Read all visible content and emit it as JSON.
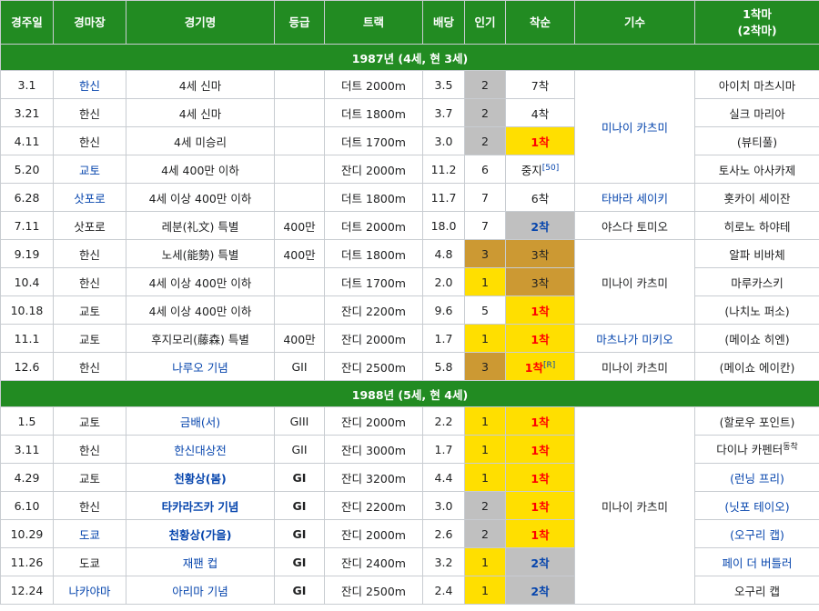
{
  "headers": [
    "경주일",
    "경마장",
    "경기명",
    "등급",
    "트랙",
    "배당",
    "인기",
    "착순",
    "기수",
    "1착마",
    "(2착마)"
  ],
  "sections": {
    "s1987": "1987년 (4세, 현 3세)",
    "s1988": "1988년 (5세, 현 4세)"
  },
  "rows": [
    {
      "date": "3.1",
      "venue": "한신",
      "race": "4세 신마",
      "grade": "",
      "track": "더트 2000m",
      "odds": "3.5",
      "pop": "2",
      "finish": "7착",
      "winner": "아이치 마츠시마"
    },
    {
      "date": "3.21",
      "venue": "한신",
      "race": "4세 신마",
      "grade": "",
      "track": "더트 1800m",
      "odds": "3.7",
      "pop": "2",
      "finish": "4착",
      "winner": "실크 마리아"
    },
    {
      "date": "4.11",
      "venue": "한신",
      "race": "4세 미승리",
      "grade": "",
      "track": "더트 1700m",
      "odds": "3.0",
      "pop": "2",
      "finish": "1착",
      "winner": "(뷰티풀)"
    },
    {
      "date": "5.20",
      "venue": "교토",
      "race": "4세 400만 이하",
      "grade": "",
      "track": "잔디 2000m",
      "odds": "11.2",
      "pop": "6",
      "finish": "중지",
      "finish_ref": "[50]",
      "winner": "토사노 아사카제"
    },
    {
      "date": "6.28",
      "venue": "삿포로",
      "race": "4세 이상 400만 이하",
      "grade": "",
      "track": "더트 1800m",
      "odds": "11.7",
      "pop": "7",
      "finish": "6착",
      "winner": "홋카이 세이잔"
    },
    {
      "date": "7.11",
      "venue": "삿포로",
      "race": "레분(礼文) 특별",
      "grade": "400만",
      "track": "더트 2000m",
      "odds": "18.0",
      "pop": "7",
      "finish": "2착",
      "winner": "히로노 하야테"
    },
    {
      "date": "9.19",
      "venue": "한신",
      "race": "노세(能勢) 특별",
      "grade": "400만",
      "track": "더트 1800m",
      "odds": "4.8",
      "pop": "3",
      "finish": "3착",
      "winner": "알파 비바체"
    },
    {
      "date": "10.4",
      "venue": "한신",
      "race": "4세 이상 400만 이하",
      "grade": "",
      "track": "더트 1700m",
      "odds": "2.0",
      "pop": "1",
      "finish": "3착",
      "winner": "마루카스키"
    },
    {
      "date": "10.18",
      "venue": "교토",
      "race": "4세 이상 400만 이하",
      "grade": "",
      "track": "잔디 2200m",
      "odds": "9.6",
      "pop": "5",
      "finish": "1착",
      "winner": "(나치노 퍼소)"
    },
    {
      "date": "11.1",
      "venue": "교토",
      "race": "후지모리(藤森) 특별",
      "grade": "400만",
      "track": "잔디 2000m",
      "odds": "1.7",
      "pop": "1",
      "finish": "1착",
      "winner": "(메이쇼 히엔)"
    },
    {
      "date": "12.6",
      "venue": "한신",
      "race": "나루오 기념",
      "grade": "GII",
      "track": "잔디 2500m",
      "odds": "5.8",
      "pop": "3",
      "finish": "1착",
      "finish_ref": "[R]",
      "winner": "(메이쇼 에이칸)"
    },
    {
      "date": "1.5",
      "venue": "교토",
      "race": "금배(서)",
      "grade": "GIII",
      "track": "잔디 2000m",
      "odds": "2.2",
      "pop": "1",
      "finish": "1착",
      "winner": "(할로우 포인트)"
    },
    {
      "date": "3.11",
      "venue": "한신",
      "race": "한신대상전",
      "grade": "GII",
      "track": "잔디 3000m",
      "odds": "1.7",
      "pop": "1",
      "finish": "1착",
      "winner": "다이나 카펜터",
      "winner_sup": "동착"
    },
    {
      "date": "4.29",
      "venue": "교토",
      "race": "천황상(봄)",
      "grade": "GI",
      "track": "잔디 3200m",
      "odds": "4.4",
      "pop": "1",
      "finish": "1착",
      "winner": "(런닝 프리)"
    },
    {
      "date": "6.10",
      "venue": "한신",
      "race": "타카라즈카 기념",
      "grade": "GI",
      "track": "잔디 2200m",
      "odds": "3.0",
      "pop": "2",
      "finish": "1착",
      "winner": "(닛포 테이오)"
    },
    {
      "date": "10.29",
      "venue": "도쿄",
      "race": "천황상(가을)",
      "grade": "GI",
      "track": "잔디 2000m",
      "odds": "2.6",
      "pop": "2",
      "finish": "1착",
      "winner": "(오구리 캡)"
    },
    {
      "date": "11.26",
      "venue": "도쿄",
      "race": "재팬 컵",
      "grade": "GI",
      "track": "잔디 2400m",
      "odds": "3.2",
      "pop": "1",
      "finish": "2착",
      "winner": "페이 더 버틀러"
    },
    {
      "date": "12.24",
      "venue": "나카야마",
      "race": "아리마 기념",
      "grade": "GI",
      "track": "잔디 2500m",
      "odds": "2.4",
      "pop": "1",
      "finish": "2착",
      "winner": "오구리 캡"
    }
  ],
  "jockeys": {
    "j1": "미나이 카츠미",
    "j2": "타바라 세이키",
    "j3": "야스다 토미오",
    "j4": "미나이 카츠미",
    "j5": "마츠나가 미키오",
    "j6": "미나이 카츠미",
    "j7": "미나이 카츠미"
  },
  "colors": {
    "header_green": "#228b22",
    "gold": "#ffdf00",
    "silver": "#c0c0c0",
    "bronze": "#cc9933",
    "link": "#0645ad",
    "win_red": "#ff0000"
  }
}
